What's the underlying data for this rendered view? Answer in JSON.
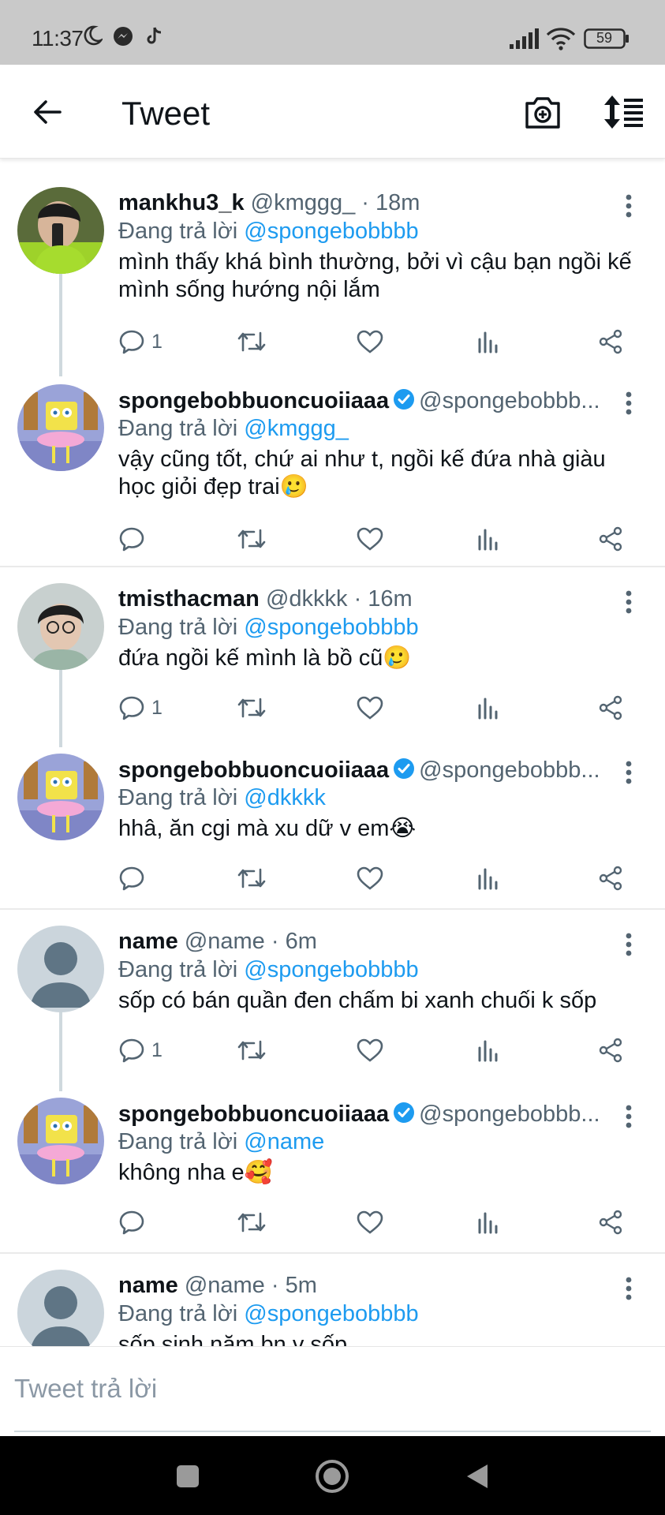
{
  "status_bar": {
    "time": "11:37",
    "battery": "59",
    "icons": [
      "moon-icon",
      "messenger-icon",
      "tiktok-icon",
      "signal-icon",
      "wifi-icon",
      "battery-icon"
    ]
  },
  "header": {
    "title": "Tweet",
    "icons": [
      "back-arrow-icon",
      "camera-add-icon",
      "sort-icon"
    ]
  },
  "tweets": [
    {
      "name": "mankhu3_k",
      "handle": "@kmggg_ · 18m",
      "reply_prefix": "Đang trả lời",
      "reply_to": "@spongebobbbb",
      "text": "mình thấy khá bình thường, bởi vì cậu bạn ngồi kế mình sống hướng nội lắm",
      "reply_count": "1",
      "verified": false
    },
    {
      "name": "spongebobbuoncuoiiaaa",
      "handle": "@spongebobbb...",
      "reply_prefix": "Đang trả lời",
      "reply_to": "@kmggg_",
      "text": "vậy cũng tốt, chứ ai như t, ngồi kế đứa nhà giàu học giỏi đẹp trai🥲",
      "reply_count": "",
      "verified": true
    },
    {
      "name": "tmisthacman",
      "handle": "@dkkkk · 16m",
      "reply_prefix": "Đang trả lời",
      "reply_to": "@spongebobbbb",
      "text": "đứa ngồi kế mình là bồ cũ🥲",
      "reply_count": "1",
      "verified": false
    },
    {
      "name": "spongebobbuoncuoiiaaa",
      "handle": "@spongebobbb...",
      "reply_prefix": "Đang trả lời",
      "reply_to": "@dkkkk",
      "text": "hhâ, ăn cgi mà xu dữ v em😭",
      "reply_count": "",
      "verified": true
    },
    {
      "name": "name",
      "handle": "@name · 6m",
      "reply_prefix": "Đang trả lời",
      "reply_to": "@spongebobbbb",
      "text": "sốp có bán quần đen chấm bi xanh chuối k sốp",
      "reply_count": "1",
      "verified": false
    },
    {
      "name": "spongebobbuoncuoiiaaa",
      "handle": "@spongebobbb...",
      "reply_prefix": "Đang trả lời",
      "reply_to": "@name",
      "text": "không nha e🥰",
      "reply_count": "",
      "verified": true
    },
    {
      "name": "name",
      "handle": "@name · 5m",
      "reply_prefix": "Đang trả lời",
      "reply_to": "@spongebobbbb",
      "text": "sốp sinh năm bn v sốp",
      "reply_count": "",
      "verified": false
    }
  ],
  "compose": {
    "placeholder": "Tweet trả lời"
  },
  "nav_bar": {
    "icons": [
      "recents-square-icon",
      "home-circle-icon",
      "back-triangle-icon"
    ]
  },
  "colors": {
    "link": "#1d9bf0",
    "muted": "#536471",
    "verified": "#1d9bf0",
    "status_bar": "#c9c9c9"
  }
}
